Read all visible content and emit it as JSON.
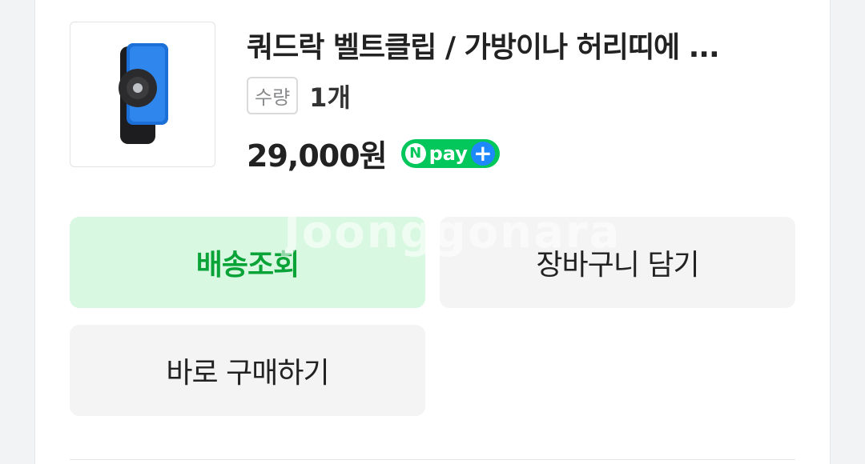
{
  "order_item": {
    "title": "쿼드락 벨트클립 / 가방이나 허리띠에 ...",
    "quantity_label": "수량",
    "quantity_value": "1개",
    "price": "29,000원",
    "npay": {
      "n": "N",
      "text": "pay",
      "plus": "+"
    },
    "image_icon": "belt-clip-product-image"
  },
  "actions": {
    "track_delivery": "배송조회",
    "add_to_cart": "장바구니 담기",
    "buy_now": "바로 구매하기"
  },
  "watermark": "Joonggonara",
  "colors": {
    "track_bg": "#d9f8e2",
    "track_text": "#0aa338",
    "neutral_btn_bg": "#f4f4f5",
    "npay_green": "#03c75a",
    "npay_blue": "#1e88ff"
  }
}
